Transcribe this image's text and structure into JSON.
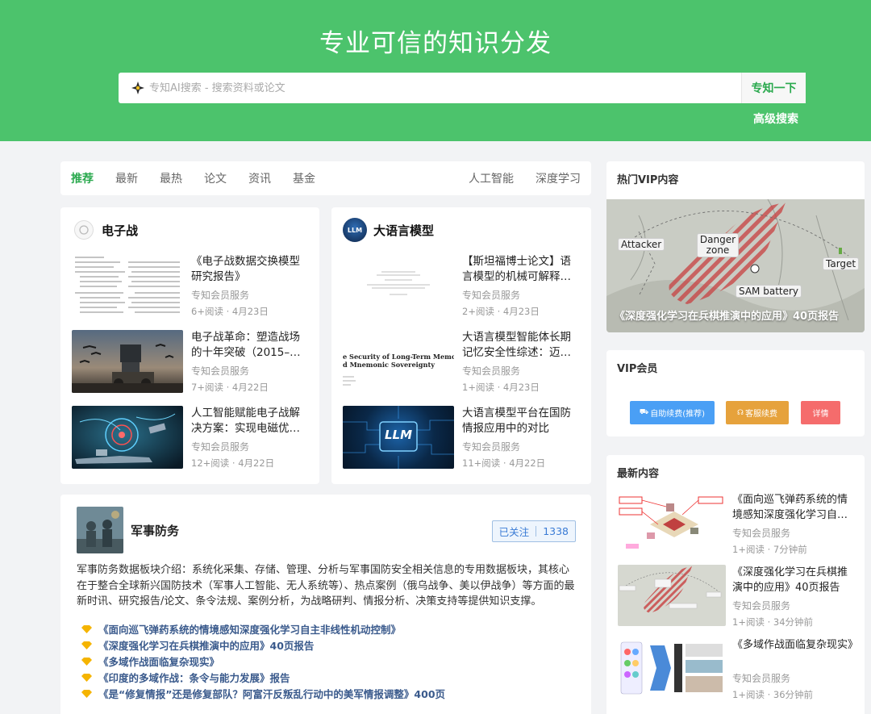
{
  "hero": {
    "title": "专业可信的知识分发",
    "search_placeholder": "专知AI搜索 - 搜索资料或论文",
    "search_button": "专知一下",
    "advanced": "高级搜索"
  },
  "tabs": {
    "left": [
      "推荐",
      "最新",
      "最热",
      "论文",
      "资讯",
      "基金"
    ],
    "right": [
      "人工智能",
      "深度学习"
    ]
  },
  "topics": [
    {
      "name": "电子战",
      "items": [
        {
          "title": "《电子战数据交换模型研究报告》",
          "source": "专知会员服务",
          "meta": "6+阅读 · 4月23日"
        },
        {
          "title": "电子战革命：塑造战场的十年突破（2015–…",
          "source": "专知会员服务",
          "meta": "7+阅读 · 4月22日"
        },
        {
          "title": "人工智能赋能电子战解决方案：实现电磁优…",
          "source": "专知会员服务",
          "meta": "12+阅读 · 4月22日"
        }
      ]
    },
    {
      "name": "大语言模型",
      "icon_text": "LLM",
      "items": [
        {
          "title": "【斯坦福博士论文】语言模型的机械可解释…",
          "source": "专知会员服务",
          "meta": "2+阅读 · 4月23日"
        },
        {
          "title": "大语言模型智能体长期记忆安全性综述：迈…",
          "source": "专知会员服务",
          "meta": "1+阅读 · 4月23日",
          "thumb_text": [
            "e Security of Long-Term Memory",
            "d Mnemonic Sovereignty"
          ]
        },
        {
          "title": "大语言模型平台在国防情报应用中的对比",
          "source": "专知会员服务",
          "meta": "11+阅读 · 4月22日",
          "thumb_text": "LLM"
        }
      ]
    }
  ],
  "defense": {
    "name": "军事防务",
    "follow_label": "已关注",
    "follow_count": "1338",
    "description": "军事防务数据板块介绍：系统化采集、存储、管理、分析与军事国防安全相关信息的专用数据板块，其核心在于整合全球新兴国防技术（军事人工智能、无人系统等）、热点案例（俄乌战争、美以伊战争）等方面的最新时讯、研究报告/论文、条令法规、案例分析，为战略研判、情报分析、决策支持等提供知识支撑。",
    "links": [
      "《面向巡飞弹药系统的情境感知深度强化学习自主非线性机动控制》",
      "《深度强化学习在兵棋推演中的应用》40页报告",
      "《多域作战面临复杂现实》",
      "《印度的多域作战：条令与能力发展》报告",
      "《是“修复情报”还是修复部队？阿富汗反叛乱行动中的美军情报调整》400页"
    ]
  },
  "sidebar": {
    "hot_vip": {
      "title": "热门VIP内容",
      "caption": "《深度强化学习在兵棋推演中的应用》40页报告",
      "labels": {
        "attacker": "Attacker",
        "danger": "Danger zone",
        "target": "Target",
        "sam": "SAM battery"
      }
    },
    "vip": {
      "title": "VIP会员",
      "btn_renew": "自助续费(推荐)",
      "btn_service": "客服续费",
      "btn_detail": "详情",
      "colors": {
        "renew": "#4a9ff5",
        "service": "#e6a23c",
        "detail": "#f56c6c"
      }
    },
    "latest": {
      "title": "最新内容",
      "items": [
        {
          "title": "《面向巡飞弹药系统的情境感知深度强化学习自…",
          "source": "专知会员服务",
          "meta": "1+阅读 · 7分钟前"
        },
        {
          "title": "《深度强化学习在兵棋推演中的应用》40页报告",
          "source": "专知会员服务",
          "meta": "1+阅读 · 34分钟前"
        },
        {
          "title": "《多域作战面临复杂现实》",
          "source": "专知会员服务",
          "meta": "1+阅读 · 36分钟前"
        }
      ]
    }
  },
  "colors": {
    "brand": "#4cc36c",
    "accent": "#2aa94e",
    "link": "#3a5a8c"
  }
}
